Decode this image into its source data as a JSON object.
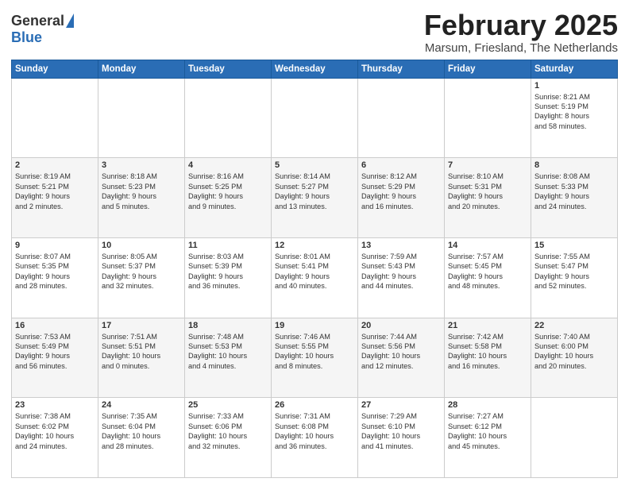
{
  "header": {
    "logo_general": "General",
    "logo_blue": "Blue",
    "month_title": "February 2025",
    "location": "Marsum, Friesland, The Netherlands"
  },
  "days_of_week": [
    "Sunday",
    "Monday",
    "Tuesday",
    "Wednesday",
    "Thursday",
    "Friday",
    "Saturday"
  ],
  "weeks": [
    [
      {
        "day": "",
        "info": ""
      },
      {
        "day": "",
        "info": ""
      },
      {
        "day": "",
        "info": ""
      },
      {
        "day": "",
        "info": ""
      },
      {
        "day": "",
        "info": ""
      },
      {
        "day": "",
        "info": ""
      },
      {
        "day": "1",
        "info": "Sunrise: 8:21 AM\nSunset: 5:19 PM\nDaylight: 8 hours\nand 58 minutes."
      }
    ],
    [
      {
        "day": "2",
        "info": "Sunrise: 8:19 AM\nSunset: 5:21 PM\nDaylight: 9 hours\nand 2 minutes."
      },
      {
        "day": "3",
        "info": "Sunrise: 8:18 AM\nSunset: 5:23 PM\nDaylight: 9 hours\nand 5 minutes."
      },
      {
        "day": "4",
        "info": "Sunrise: 8:16 AM\nSunset: 5:25 PM\nDaylight: 9 hours\nand 9 minutes."
      },
      {
        "day": "5",
        "info": "Sunrise: 8:14 AM\nSunset: 5:27 PM\nDaylight: 9 hours\nand 13 minutes."
      },
      {
        "day": "6",
        "info": "Sunrise: 8:12 AM\nSunset: 5:29 PM\nDaylight: 9 hours\nand 16 minutes."
      },
      {
        "day": "7",
        "info": "Sunrise: 8:10 AM\nSunset: 5:31 PM\nDaylight: 9 hours\nand 20 minutes."
      },
      {
        "day": "8",
        "info": "Sunrise: 8:08 AM\nSunset: 5:33 PM\nDaylight: 9 hours\nand 24 minutes."
      }
    ],
    [
      {
        "day": "9",
        "info": "Sunrise: 8:07 AM\nSunset: 5:35 PM\nDaylight: 9 hours\nand 28 minutes."
      },
      {
        "day": "10",
        "info": "Sunrise: 8:05 AM\nSunset: 5:37 PM\nDaylight: 9 hours\nand 32 minutes."
      },
      {
        "day": "11",
        "info": "Sunrise: 8:03 AM\nSunset: 5:39 PM\nDaylight: 9 hours\nand 36 minutes."
      },
      {
        "day": "12",
        "info": "Sunrise: 8:01 AM\nSunset: 5:41 PM\nDaylight: 9 hours\nand 40 minutes."
      },
      {
        "day": "13",
        "info": "Sunrise: 7:59 AM\nSunset: 5:43 PM\nDaylight: 9 hours\nand 44 minutes."
      },
      {
        "day": "14",
        "info": "Sunrise: 7:57 AM\nSunset: 5:45 PM\nDaylight: 9 hours\nand 48 minutes."
      },
      {
        "day": "15",
        "info": "Sunrise: 7:55 AM\nSunset: 5:47 PM\nDaylight: 9 hours\nand 52 minutes."
      }
    ],
    [
      {
        "day": "16",
        "info": "Sunrise: 7:53 AM\nSunset: 5:49 PM\nDaylight: 9 hours\nand 56 minutes."
      },
      {
        "day": "17",
        "info": "Sunrise: 7:51 AM\nSunset: 5:51 PM\nDaylight: 10 hours\nand 0 minutes."
      },
      {
        "day": "18",
        "info": "Sunrise: 7:48 AM\nSunset: 5:53 PM\nDaylight: 10 hours\nand 4 minutes."
      },
      {
        "day": "19",
        "info": "Sunrise: 7:46 AM\nSunset: 5:55 PM\nDaylight: 10 hours\nand 8 minutes."
      },
      {
        "day": "20",
        "info": "Sunrise: 7:44 AM\nSunset: 5:56 PM\nDaylight: 10 hours\nand 12 minutes."
      },
      {
        "day": "21",
        "info": "Sunrise: 7:42 AM\nSunset: 5:58 PM\nDaylight: 10 hours\nand 16 minutes."
      },
      {
        "day": "22",
        "info": "Sunrise: 7:40 AM\nSunset: 6:00 PM\nDaylight: 10 hours\nand 20 minutes."
      }
    ],
    [
      {
        "day": "23",
        "info": "Sunrise: 7:38 AM\nSunset: 6:02 PM\nDaylight: 10 hours\nand 24 minutes."
      },
      {
        "day": "24",
        "info": "Sunrise: 7:35 AM\nSunset: 6:04 PM\nDaylight: 10 hours\nand 28 minutes."
      },
      {
        "day": "25",
        "info": "Sunrise: 7:33 AM\nSunset: 6:06 PM\nDaylight: 10 hours\nand 32 minutes."
      },
      {
        "day": "26",
        "info": "Sunrise: 7:31 AM\nSunset: 6:08 PM\nDaylight: 10 hours\nand 36 minutes."
      },
      {
        "day": "27",
        "info": "Sunrise: 7:29 AM\nSunset: 6:10 PM\nDaylight: 10 hours\nand 41 minutes."
      },
      {
        "day": "28",
        "info": "Sunrise: 7:27 AM\nSunset: 6:12 PM\nDaylight: 10 hours\nand 45 minutes."
      },
      {
        "day": "",
        "info": ""
      }
    ]
  ]
}
